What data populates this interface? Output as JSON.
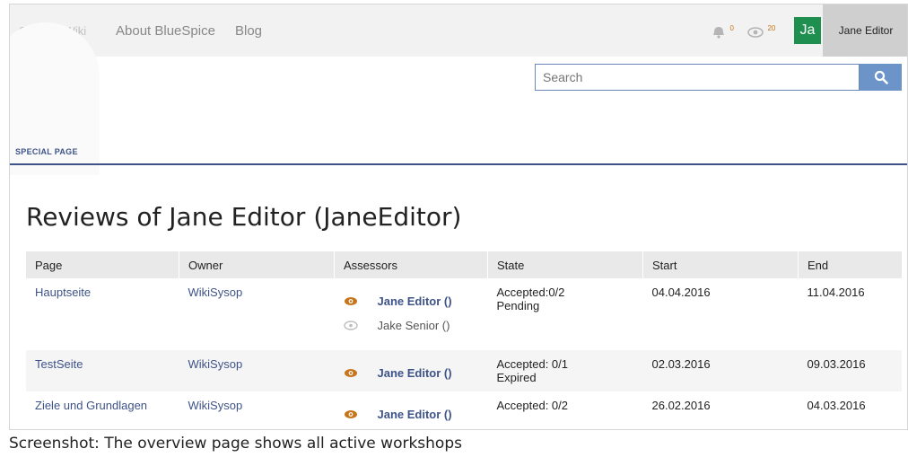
{
  "topbar": {
    "logo": "SchnakoWiki",
    "nav": [
      "About BlueSpice",
      "Blog"
    ],
    "notifications_count": "0",
    "watch_count": "20",
    "avatar_initials": "Ja",
    "user_name": "Jane Editor"
  },
  "search": {
    "placeholder": "Search"
  },
  "special_page_label": "SPECIAL PAGE",
  "page_title": "Reviews of Jane Editor (JaneEditor)",
  "table": {
    "headers": [
      "Page",
      "Owner",
      "Assessors",
      "State",
      "Start",
      "End"
    ],
    "rows": [
      {
        "page": "Hauptseite",
        "owner": "WikiSysop",
        "assessors": [
          {
            "name": "Jane Editor ()",
            "active": true
          },
          {
            "name": "Jake Senior ()",
            "active": false
          }
        ],
        "state_line1": "Accepted:0/2",
        "state_line2": "Pending",
        "start": "04.04.2016",
        "end": "11.04.2016"
      },
      {
        "page": "TestSeite",
        "owner": "WikiSysop",
        "assessors": [
          {
            "name": "Jane Editor ()",
            "active": true
          }
        ],
        "state_line1": "Accepted: 0/1",
        "state_line2": "Expired",
        "start": "02.03.2016",
        "end": "09.03.2016"
      },
      {
        "page": "Ziele und Grundlagen",
        "owner": "WikiSysop",
        "assessors": [
          {
            "name": "Jane Editor ()",
            "active": true
          }
        ],
        "state_line1": "Accepted: 0/2",
        "state_line2": "",
        "start": "26.02.2016",
        "end": "04.03.2016"
      }
    ]
  },
  "caption": "Screenshot: The overview page shows all active workshops",
  "colors": {
    "accent": "#3e5389",
    "search_button": "#6d94c9",
    "avatar": "#1e8f4e",
    "eye_active": "#c8741a",
    "eye_inactive": "#bdbdbd"
  }
}
